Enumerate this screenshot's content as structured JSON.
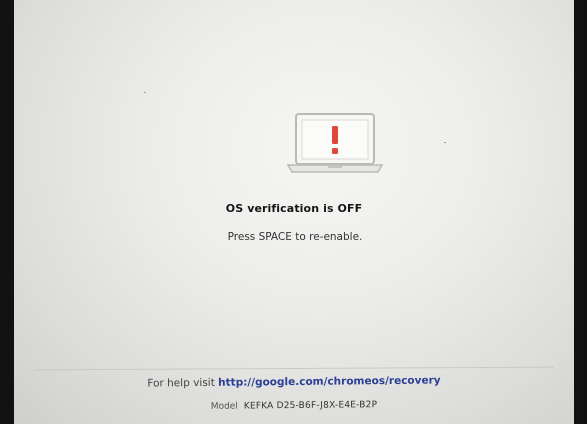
{
  "screen": {
    "title": "OS verification is OFF",
    "subtitle": "Press SPACE to re-enable.",
    "help_prefix": "For help visit",
    "help_link": "http://google.com/chromeos/recovery",
    "model_label": "Model",
    "model_value": "KEFKA D25-B6F-J8X-E4E-B2P"
  },
  "colors": {
    "background": "#ececea",
    "warning_icon": "#e0463a",
    "link": "#2a3f95"
  },
  "icons": {
    "laptop": "laptop-warning-icon"
  }
}
